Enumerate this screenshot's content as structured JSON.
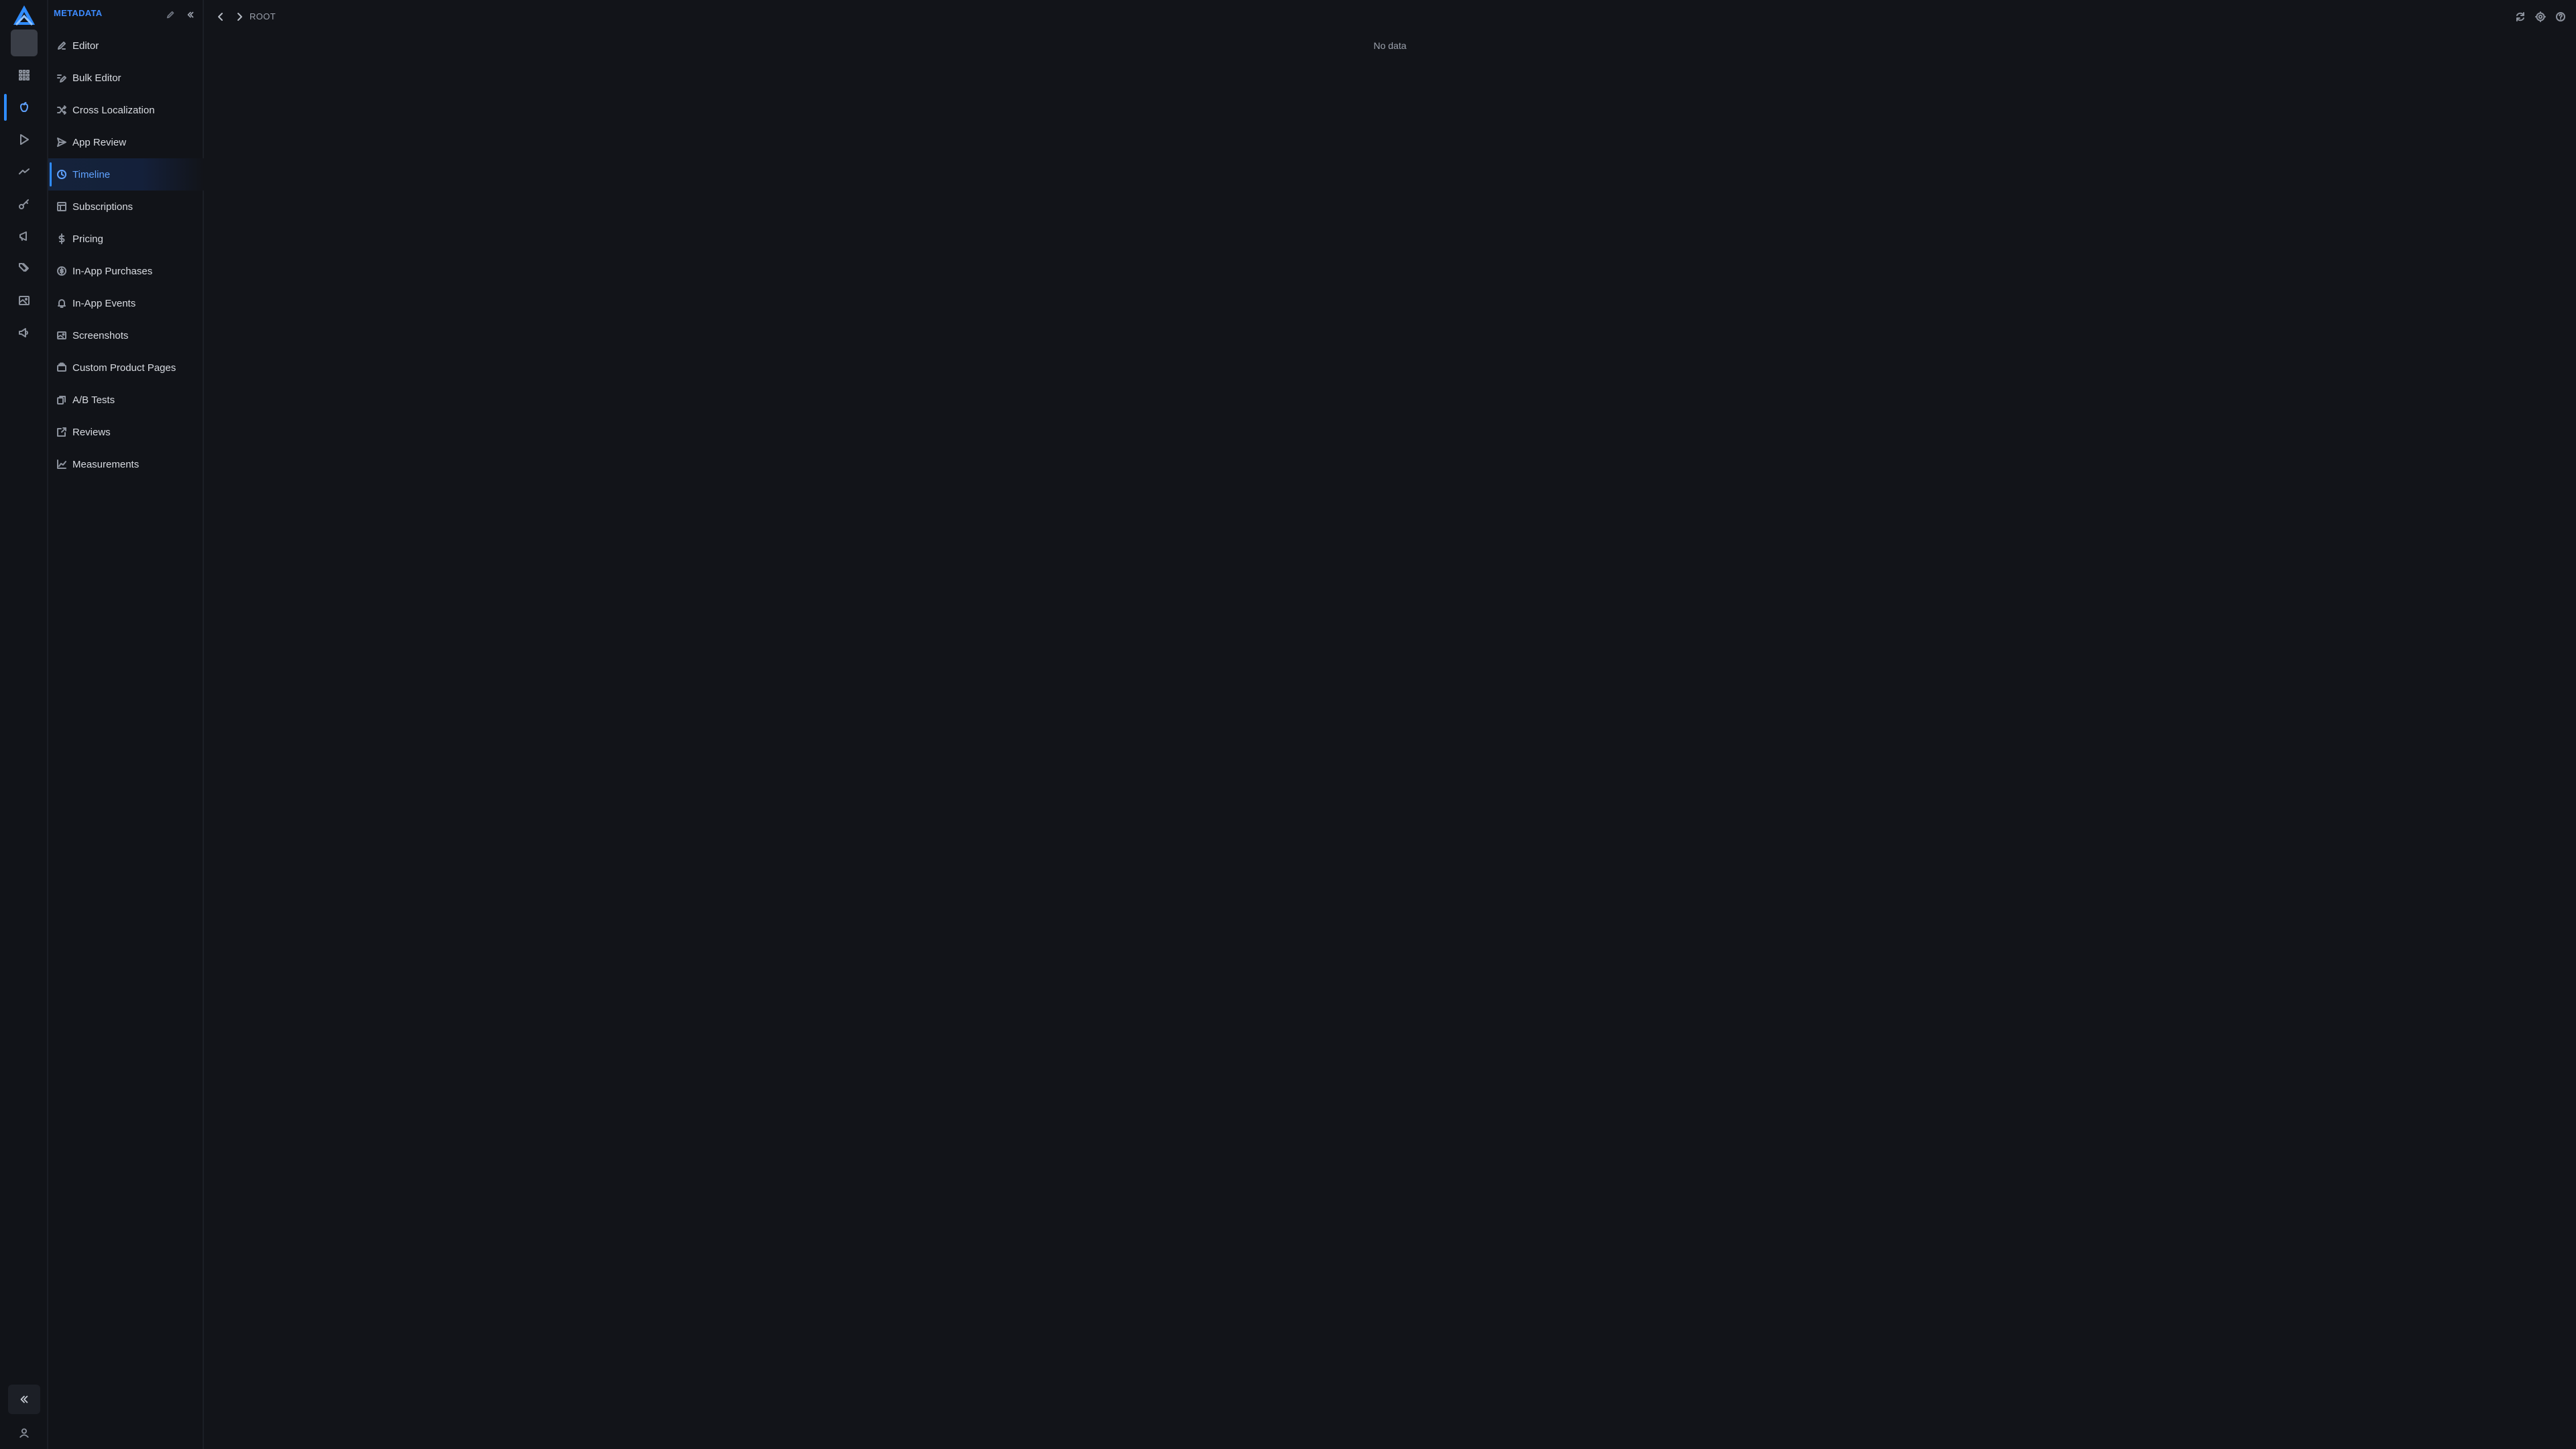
{
  "app": {
    "section_title": "METADATA",
    "brand_color": "#2f8cff"
  },
  "rail": {
    "items": [
      {
        "icon": "grid-icon"
      },
      {
        "icon": "apple-icon",
        "active": true
      },
      {
        "icon": "play-store-icon"
      },
      {
        "icon": "trend-icon"
      },
      {
        "icon": "key-icon"
      },
      {
        "icon": "megaphone-icon"
      },
      {
        "icon": "tags-icon"
      },
      {
        "icon": "image-icon"
      },
      {
        "icon": "bullhorn-icon"
      }
    ]
  },
  "sidebar": {
    "items": [
      {
        "label": "Editor",
        "icon": "pencil-icon"
      },
      {
        "label": "Bulk Editor",
        "icon": "bulk-edit-icon"
      },
      {
        "label": "Cross Localization",
        "icon": "shuffle-icon"
      },
      {
        "label": "App Review",
        "icon": "send-icon"
      },
      {
        "label": "Timeline",
        "icon": "clock-icon",
        "active": true
      },
      {
        "label": "Subscriptions",
        "icon": "subscriptions-icon"
      },
      {
        "label": "Pricing",
        "icon": "dollar-icon"
      },
      {
        "label": "In-App Purchases",
        "icon": "coin-icon"
      },
      {
        "label": "In-App Events",
        "icon": "bell-icon"
      },
      {
        "label": "Screenshots",
        "icon": "screenshot-icon"
      },
      {
        "label": "Custom Product Pages",
        "icon": "layers-icon"
      },
      {
        "label": "A/B Tests",
        "icon": "ab-test-icon"
      },
      {
        "label": "Reviews",
        "icon": "review-icon"
      },
      {
        "label": "Measurements",
        "icon": "chart-icon"
      }
    ]
  },
  "main": {
    "breadcrumb": "ROOT",
    "empty_message": "No data"
  }
}
